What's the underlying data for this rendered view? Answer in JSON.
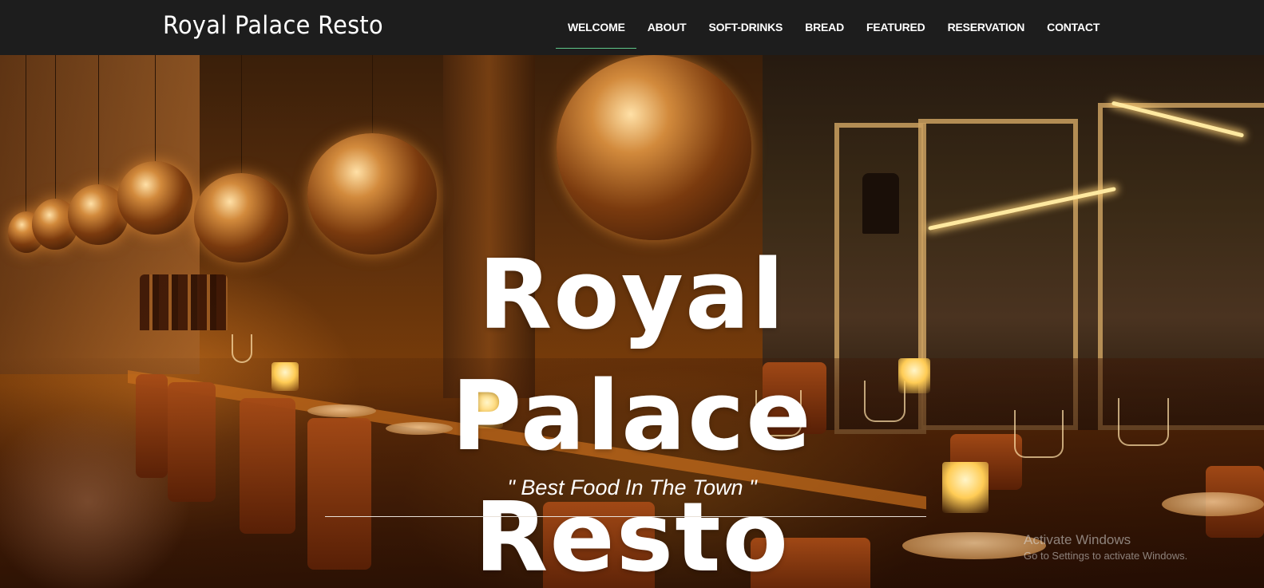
{
  "navbar": {
    "brand": "Royal Palace Resto",
    "items": [
      {
        "label": "WELCOME",
        "active": true
      },
      {
        "label": "ABOUT",
        "active": false
      },
      {
        "label": "SOFT-DRINKS",
        "active": false
      },
      {
        "label": "BREAD",
        "active": false
      },
      {
        "label": "FEATURED",
        "active": false
      },
      {
        "label": "RESERVATION",
        "active": false
      },
      {
        "label": "CONTACT",
        "active": false
      }
    ],
    "active_underline_color": "#5fc88a",
    "background_color": "#1d1d1d"
  },
  "hero": {
    "title_line1": "Royal Palace",
    "title_line2": "Resto",
    "tagline": "\" Best Food In The Town \"",
    "background_image": "restaurant-interior-photo"
  },
  "os_watermark": {
    "title": "Activate Windows",
    "subtitle": "Go to Settings to activate Windows."
  }
}
